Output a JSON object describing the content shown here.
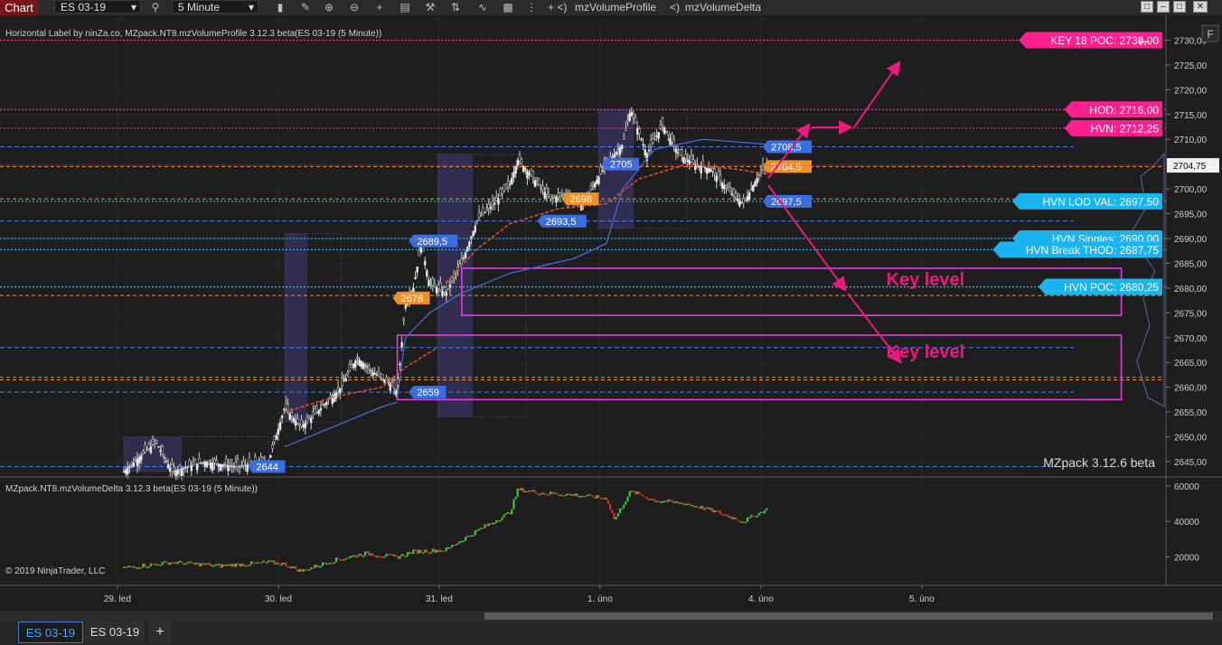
{
  "toolbar": {
    "app_tab": "Chart",
    "instrument": "ES 03-19",
    "interval": "5 Minute",
    "indicator_1": "mzVolumeProfile",
    "indicator_2": "mzVolumeDelta",
    "nav_prefix_1": "+ <)",
    "nav_prefix_2": "<)"
  },
  "price_panel": {
    "title": "Horizontal Label by ninZa.co, MZpack.NT8.mzVolumeProfile 3.12.3 beta(ES 03-19 (5 Minute))",
    "watermark": "MZpack 3.12.6 beta",
    "corner_button": "F",
    "current_price": "2704,75"
  },
  "delta_panel": {
    "title": "MZpack.NT8.mzVolumeDelta 3.12.3 beta(ES 03-19 (5 Minute))",
    "copyright": "© 2019 NinjaTrader, LLC"
  },
  "chart_data": {
    "type": "candlestick",
    "instrument": "ES 03-19",
    "price_axis": {
      "ylim": [
        2643,
        2733
      ],
      "ticks": [
        "2730,00",
        "2725,00",
        "2720,00",
        "2715,00",
        "2710,00",
        "2705,00",
        "2700,00",
        "2695,00",
        "2690,00",
        "2685,00",
        "2680,00",
        "2675,00",
        "2670,00",
        "2665,00",
        "2660,00",
        "2655,00",
        "2650,00",
        "2645,00"
      ]
    },
    "delta_axis": {
      "ylim": [
        5000,
        63000
      ],
      "ticks": [
        "60000",
        "40000",
        "20000"
      ]
    },
    "x_axis": {
      "ticks": [
        "29. led",
        "30. led",
        "31. led",
        "1. úno",
        "4. úno",
        "5. úno"
      ],
      "xlim": [
        0,
        7.5
      ]
    },
    "horizontal_labels": [
      {
        "text": "KEY 18 POC: 2730,00",
        "price": 2730.0,
        "color": "#ff1f8e",
        "line": "dotted"
      },
      {
        "text": "HOD: 2716,00",
        "price": 2716.0,
        "color": "#ff1f8e",
        "line": "dotted"
      },
      {
        "text": "HVN: 2712,25",
        "price": 2712.25,
        "color": "#ff1f8e",
        "line": "dotted"
      },
      {
        "text": "HVN LOD VAL: 2697,50",
        "price": 2697.5,
        "color": "#1ab4f0",
        "line": "dotted"
      },
      {
        "text": "HVN Singles: 2690,00",
        "price": 2690.0,
        "color": "#1ab4f0",
        "line": "dotted"
      },
      {
        "text": "HVN Break THOD: 2687,75",
        "price": 2687.75,
        "color": "#1ab4f0",
        "line": "dotted"
      },
      {
        "text": "HVN POC: 2680,25",
        "price": 2680.25,
        "color": "#1ab4f0",
        "line": "dotted"
      }
    ],
    "level_tags": [
      {
        "text": "2708,5",
        "price": 2708.5,
        "day": 4.0
      },
      {
        "text": "2705",
        "price": 2705.0,
        "day": 3.0
      },
      {
        "text": "2704,5",
        "price": 2704.5,
        "day": 4.0,
        "orange": true
      },
      {
        "text": "2698",
        "price": 2698.0,
        "day": 2.75,
        "orange": true
      },
      {
        "text": "2697,5",
        "price": 2697.5,
        "day": 4.0
      },
      {
        "text": "2693,5",
        "price": 2693.5,
        "day": 2.6
      },
      {
        "text": "2689,5",
        "price": 2689.5,
        "day": 1.8
      },
      {
        "text": "2678",
        "price": 2678.0,
        "day": 1.7,
        "orange": true
      },
      {
        "text": "2659",
        "price": 2659.0,
        "day": 1.8
      },
      {
        "text": "2644",
        "price": 2644.0,
        "day": 0.8
      }
    ],
    "annotations": [
      {
        "text": "Key level",
        "price": 2680.5,
        "day": 4.75
      },
      {
        "text": "Key level",
        "price": 2666.0,
        "day": 4.75
      }
    ],
    "zones": [
      {
        "price_top": 2684.0,
        "price_bottom": 2674.5,
        "day_start": 2.1,
        "day_end": 6.2
      },
      {
        "price_top": 2670.5,
        "price_bottom": 2657.5,
        "day_start": 1.7,
        "day_end": 6.2
      }
    ],
    "price_path": [
      [
        0.0,
        2643
      ],
      [
        0.1,
        2646
      ],
      [
        0.2,
        2649
      ],
      [
        0.3,
        2643
      ],
      [
        0.5,
        2645
      ],
      [
        0.7,
        2644
      ],
      [
        0.9,
        2645
      ],
      [
        1.0,
        2656
      ],
      [
        1.1,
        2652
      ],
      [
        1.2,
        2655
      ],
      [
        1.35,
        2660
      ],
      [
        1.45,
        2666
      ],
      [
        1.55,
        2663
      ],
      [
        1.65,
        2661
      ],
      [
        1.7,
        2659
      ],
      [
        1.75,
        2677
      ],
      [
        1.8,
        2680
      ],
      [
        1.85,
        2689
      ],
      [
        1.9,
        2681
      ],
      [
        2.0,
        2679
      ],
      [
        2.1,
        2685
      ],
      [
        2.2,
        2694
      ],
      [
        2.3,
        2697
      ],
      [
        2.4,
        2701
      ],
      [
        2.45,
        2706
      ],
      [
        2.55,
        2702
      ],
      [
        2.65,
        2698
      ],
      [
        2.75,
        2699
      ],
      [
        2.85,
        2697
      ],
      [
        3.0,
        2705
      ],
      [
        3.1,
        2709
      ],
      [
        3.15,
        2716
      ],
      [
        3.25,
        2707
      ],
      [
        3.35,
        2713
      ],
      [
        3.45,
        2707
      ],
      [
        3.55,
        2705
      ],
      [
        3.65,
        2704
      ],
      [
        3.75,
        2700
      ],
      [
        3.85,
        2697
      ],
      [
        3.95,
        2703
      ],
      [
        4.0,
        2705
      ]
    ],
    "delta_path": [
      [
        0.0,
        14000
      ],
      [
        0.3,
        17000
      ],
      [
        0.6,
        15000
      ],
      [
        0.9,
        17000
      ],
      [
        1.0,
        16000
      ],
      [
        1.1,
        12000
      ],
      [
        1.3,
        18000
      ],
      [
        1.5,
        22000
      ],
      [
        1.7,
        20000
      ],
      [
        1.8,
        23000
      ],
      [
        2.0,
        24000
      ],
      [
        2.2,
        35000
      ],
      [
        2.4,
        45000
      ],
      [
        2.45,
        58000
      ],
      [
        2.6,
        56000
      ],
      [
        2.8,
        55000
      ],
      [
        3.0,
        53000
      ],
      [
        3.05,
        41000
      ],
      [
        3.15,
        57000
      ],
      [
        3.3,
        52000
      ],
      [
        3.5,
        50000
      ],
      [
        3.7,
        45000
      ],
      [
        3.85,
        40000
      ],
      [
        4.0,
        47000
      ]
    ]
  },
  "bottom_tabs": [
    {
      "label": "ES 03-19",
      "active": true
    },
    {
      "label": "ES 03-19",
      "active": false
    },
    {
      "label": "+",
      "active": false
    }
  ]
}
